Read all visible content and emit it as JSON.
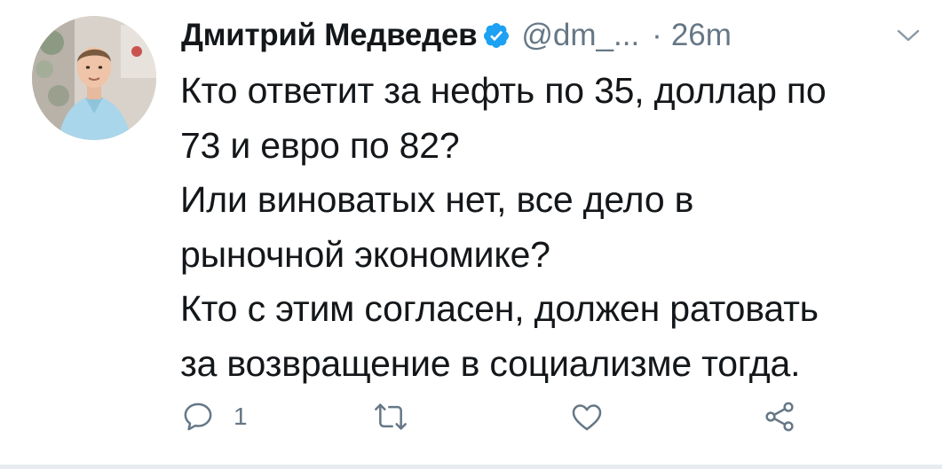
{
  "author": {
    "display_name": "Дмитрий Медведев",
    "handle": "@dm_...",
    "verified": true
  },
  "meta": {
    "separator": "·",
    "time": "26m"
  },
  "tweet": {
    "lines": [
      "Кто ответит за нефть по 35, доллар по",
      "73 и евро по 82?",
      "Или виноватых нет, все дело в",
      "рыночной экономике?",
      "Кто с этим согласен, должен ратовать",
      "за возвращение в социализме тогда."
    ]
  },
  "actions": {
    "reply_count": "1",
    "icons": [
      "reply-icon",
      "retweet-icon",
      "like-icon",
      "share-icon"
    ]
  },
  "colors": {
    "text": "#14171a",
    "secondary": "#657786",
    "verified_blue": "#1da1f2",
    "divider": "#e6ecf0"
  }
}
